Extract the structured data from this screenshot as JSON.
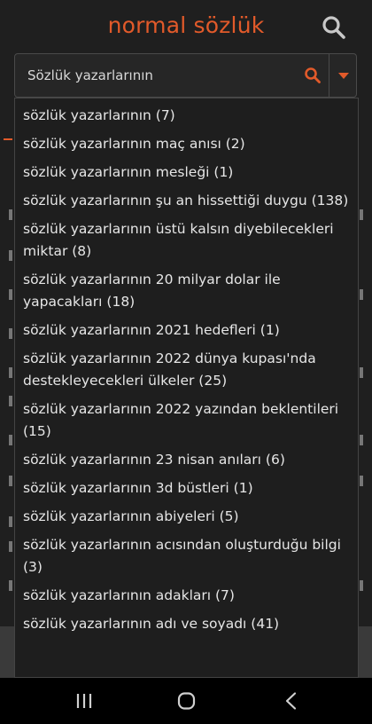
{
  "app": {
    "logo": "normal sözlük"
  },
  "search": {
    "value": "Sözlük yazarlarının"
  },
  "suggestions": [
    "sözlük yazarlarının (7)",
    "sözlük yazarlarının maç anısı (2)",
    "sözlük yazarlarının mesleği (1)",
    "sözlük yazarlarının şu an hissettiği duygu (138)",
    "sözlük yazarlarının üstü kalsın diyebilecekleri miktar (8)",
    "sözlük yazarlarının 20 milyar dolar ile yapacakları (18)",
    "sözlük yazarlarının 2021 hedefleri (1)",
    "sözlük yazarlarının 2022 dünya kupası'nda destekleyecekleri ülkeler (25)",
    "sözlük yazarlarının 2022 yazından beklentileri (15)",
    "sözlük yazarlarının 23 nisan anıları (6)",
    "sözlük yazarlarının 3d büstleri (1)",
    "sözlük yazarlarının abiyeleri (5)",
    "sözlük yazarlarının acısından oluşturduğu bilgi (3)",
    "sözlük yazarlarının adakları (7)",
    "sözlük yazarlarının adı ve soyadı (41)"
  ],
  "colors": {
    "accent": "#e25a2a",
    "background": "#1f1f1f",
    "text": "#e6e6e6",
    "navbar": "#000000"
  },
  "icons": {
    "top_search": "search-icon",
    "search_go": "search-icon",
    "dropdown": "caret-down-icon",
    "nav_recents": "recent-apps-icon",
    "nav_home": "home-icon",
    "nav_back": "back-icon"
  }
}
